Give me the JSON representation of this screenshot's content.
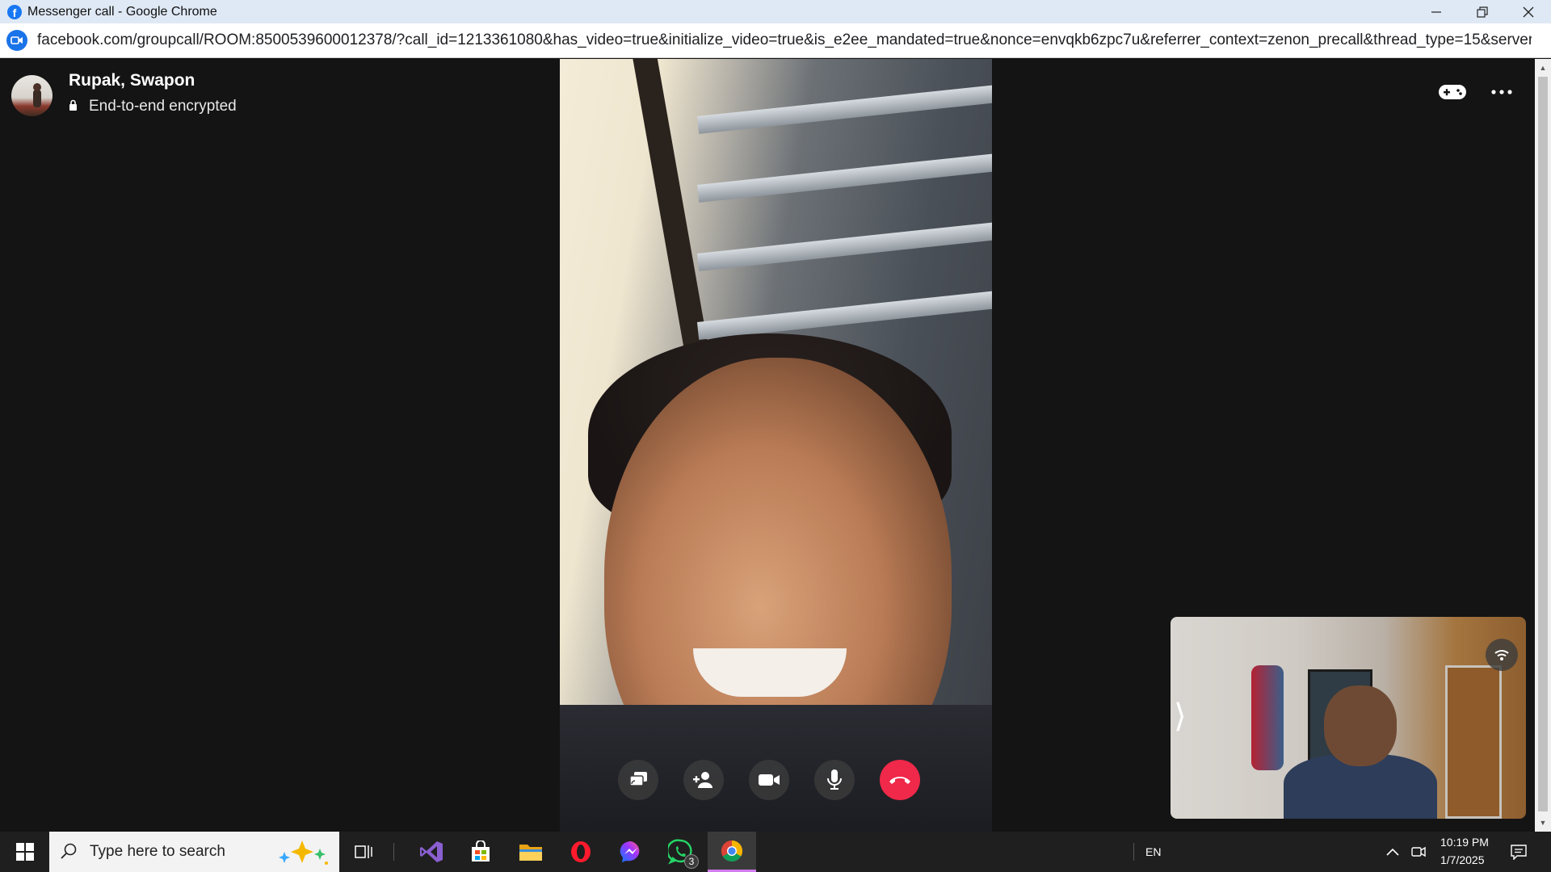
{
  "window": {
    "title": "Messenger call - Google Chrome",
    "url": "facebook.com/groupcall/ROOM:8500539600012378/?call_id=1213361080&has_video=true&initialize_video=true&is_e2ee_mandated=true&nonce=envqkb6zpc7u&referrer_context=zenon_precall&thread_type=15&server_info_data=GAN..."
  },
  "call": {
    "name": "Rupak, Swapon",
    "encryption": "End-to-end encrypted"
  },
  "taskbar": {
    "search_placeholder": "Type here to search",
    "whatsapp_badge": "3",
    "language": "EN",
    "time": "10:19 PM",
    "date": "1/7/2025"
  }
}
